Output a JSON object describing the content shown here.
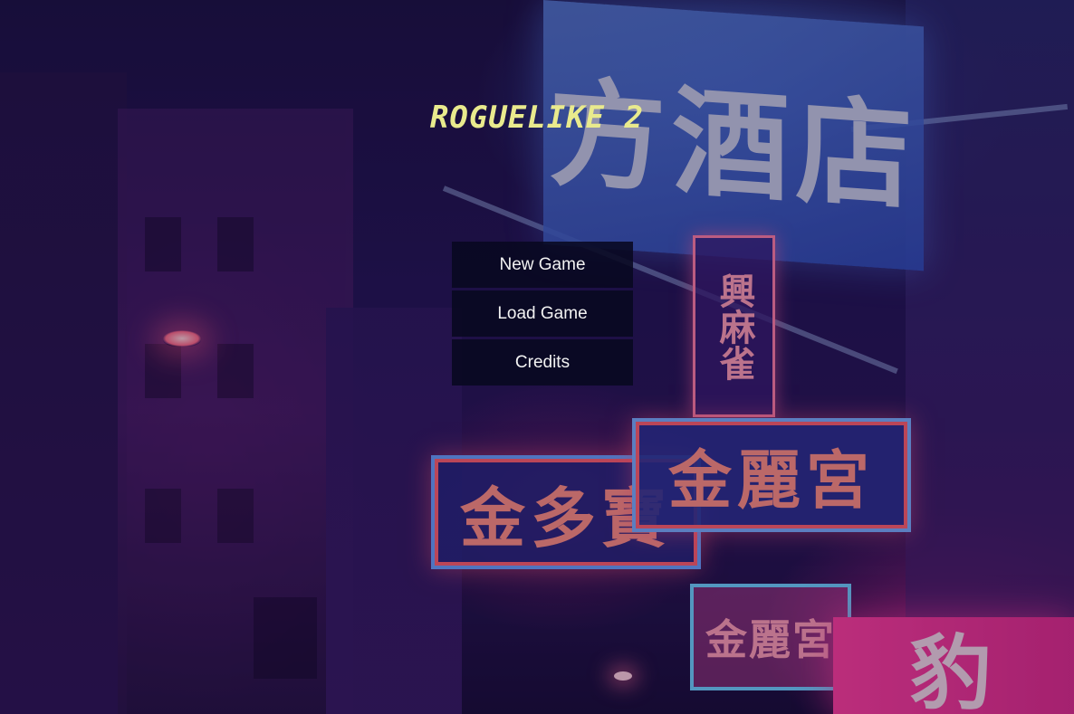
{
  "game": {
    "title": "ROGUELIKE 2",
    "title_color": "#e9ea8d"
  },
  "menu": {
    "items": [
      {
        "label": "New Game"
      },
      {
        "label": "Load Game"
      },
      {
        "label": "Credits"
      }
    ]
  },
  "background": {
    "signs": {
      "top": "方酒店",
      "vertical": "興麻雀",
      "left": "金多寶",
      "right": "金麗宮",
      "lower": "金麗宮",
      "corner": "豹"
    },
    "accent_colors": [
      "#4a6fd8",
      "#ff3ea0",
      "#ff8f86",
      "#2a1658"
    ]
  }
}
